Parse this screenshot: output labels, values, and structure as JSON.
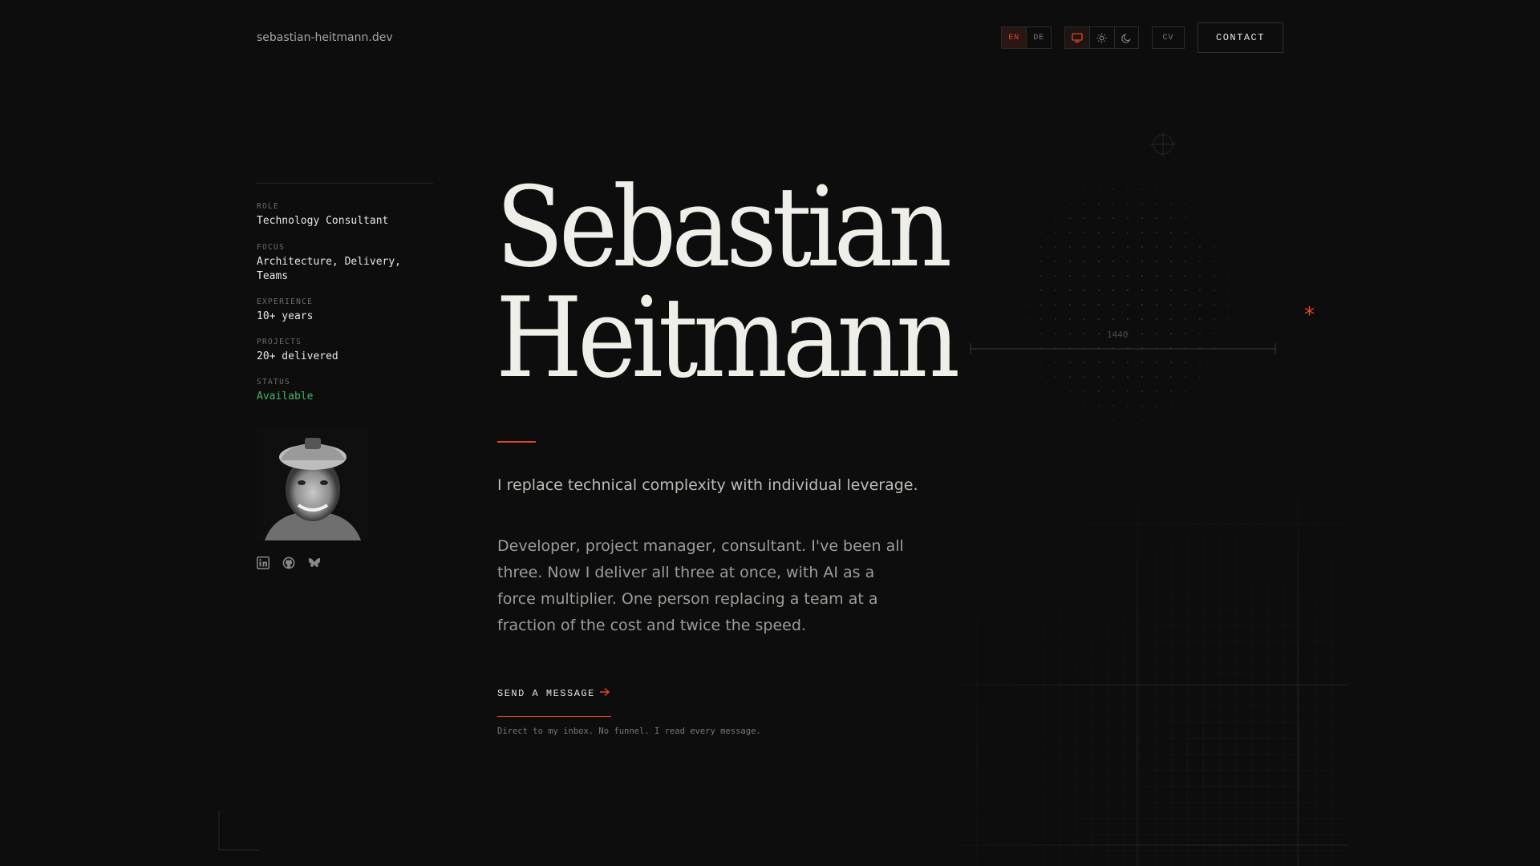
{
  "header": {
    "site_name": "sebastian-heitmann.dev",
    "lang_options": [
      "EN",
      "DE"
    ],
    "lang_active": "EN",
    "theme_options": [
      "system-theme-icon",
      "sun-icon",
      "moon-icon"
    ],
    "theme_active": "system",
    "cv_label": "CV",
    "contact_label": "CONTACT"
  },
  "sidebar": {
    "facts": [
      {
        "label": "ROLE",
        "value": "Technology Consultant"
      },
      {
        "label": "FOCUS",
        "value": "Architecture, Delivery, Teams"
      },
      {
        "label": "EXPERIENCE",
        "value": "10+ years"
      },
      {
        "label": "PROJECTS",
        "value": "20+ delivered"
      },
      {
        "label": "STATUS",
        "value": "Available"
      }
    ],
    "socials": [
      "linkedin-icon",
      "github-icon",
      "bluesky-icon"
    ]
  },
  "hero": {
    "name_line1": "Sebastian",
    "name_line2": "Heitmann",
    "tagline": "I replace technical complexity with individual leverage.",
    "bio": "Developer, project manager, consultant. I've been all three. Now I deliver all three at once, with AI as a force multiplier. One person replacing a team at a fraction of the cost and twice the speed.",
    "cta_label": "SEND A MESSAGE",
    "cta_note": "Direct to my inbox. No funnel. I read every message."
  },
  "decor": {
    "ruler_label": "1440",
    "star": "*"
  },
  "colors": {
    "background": "#0d0d0d",
    "accent": "#e0462b",
    "status_green": "#3fb567",
    "text": "#e8e6e1"
  }
}
